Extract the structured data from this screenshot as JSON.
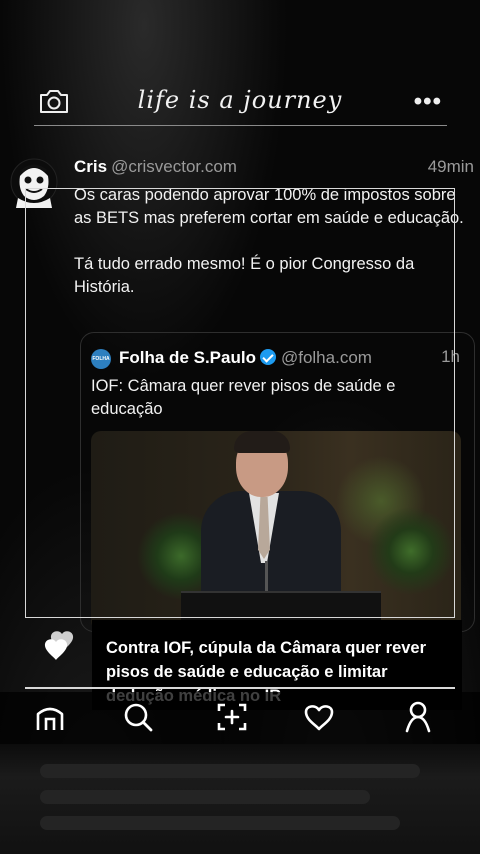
{
  "header": {
    "title": "life is a journey",
    "camera_icon": "camera-icon",
    "more_icon": "more-icon"
  },
  "post": {
    "author_name": "Cris",
    "author_handle": "@crisvector.com",
    "time": "49min",
    "text": "Os caras podendo aprovar 100% de impostos sobre as BETS mas preferem cortar em saúde e educação.\n\nTá tudo errado mesmo! É o pior Congresso da História.",
    "quote": {
      "source_name": "Folha de S.Paulo",
      "source_handle": "@folha.com",
      "logo_text": "FOLHA",
      "time": "1h",
      "text": "IOF: Câmara quer rever pisos de saúde e educação"
    }
  },
  "card": {
    "text": "Contra IOF, cúpula da Câmara quer rever pisos de saúde e educação e limitar dedução médica no IR"
  },
  "tabbar": {
    "items": [
      "home-icon",
      "search-icon",
      "add-photo-icon",
      "heart-icon",
      "profile-icon"
    ]
  },
  "colors": {
    "background": "#050505",
    "muted_text": "#9a9a9a",
    "verified": "#1d9bf0",
    "folha_logo": "#2d7fbf"
  }
}
